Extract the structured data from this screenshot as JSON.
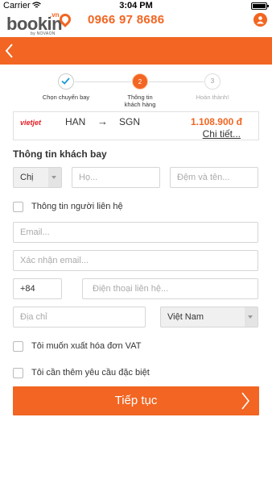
{
  "status_bar": {
    "carrier": "Carrier",
    "time": "3:04 PM"
  },
  "header": {
    "logo_text": "bookin",
    "logo_domain": ".vn",
    "logo_sub": "by NOVAON",
    "hotline": "0966 97 8686",
    "brand_color": "#f26522"
  },
  "steps": [
    {
      "label_line1": "Chọn chuyến bay",
      "label_line2": "",
      "state": "done"
    },
    {
      "number": "2",
      "label_line1": "Thông tin",
      "label_line2": "khách hàng",
      "state": "active"
    },
    {
      "number": "3",
      "label_line1": "Hoàn thành!",
      "label_line2": "",
      "state": "pending"
    }
  ],
  "flight": {
    "airline": "vietjet",
    "from": "HAN",
    "arrow": "→",
    "to": "SGN",
    "price": "1.108.900 đ",
    "detail_link": "Chi tiết..."
  },
  "form": {
    "section_title": "Thông tin khách bay",
    "title_select": "Chị",
    "last_name_placeholder": "Họ...",
    "first_name_placeholder": "Đệm và tên...",
    "contact_checkbox_label": "Thông tin người liên hệ",
    "email_placeholder": "Email...",
    "confirm_email_placeholder": "Xác nhận email...",
    "phone_code": "+84",
    "phone_placeholder": "Điện thoại liên hệ...",
    "address_placeholder": "Địa chỉ",
    "country_select": "Việt Nam",
    "vat_checkbox_label": "Tôi muốn xuất hóa đơn VAT",
    "special_checkbox_label": "Tôi cần thêm yêu cầu đặc biệt",
    "submit_label": "Tiếp tục"
  }
}
